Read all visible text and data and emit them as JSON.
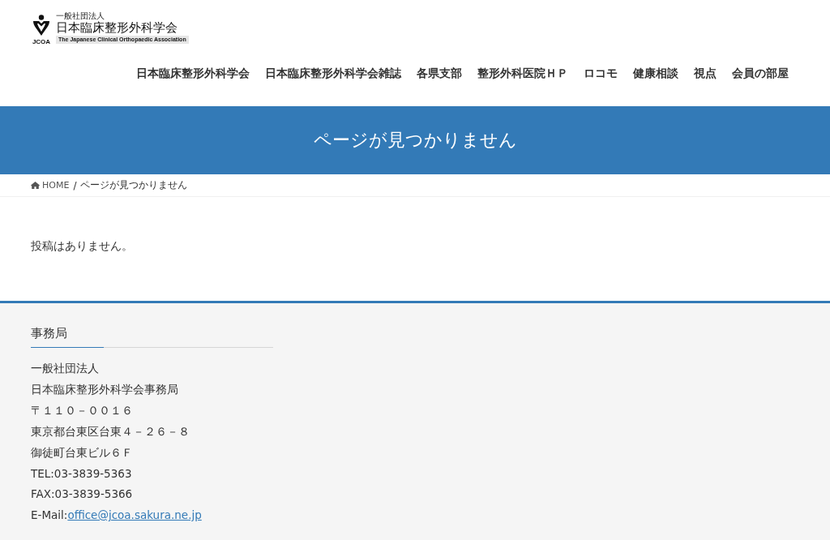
{
  "header": {
    "logo": {
      "abbr": "JCOA",
      "org_type": "一般社団法人",
      "name": "日本臨床整形外科学会",
      "english": "The Japanese Clinical Orthopaedic Association"
    },
    "nav": [
      {
        "label": "日本臨床整形外科学会"
      },
      {
        "label": "日本臨床整形外科学会雑誌"
      },
      {
        "label": "各県支部"
      },
      {
        "label": "整形外科医院ＨＰ"
      },
      {
        "label": "ロコモ"
      },
      {
        "label": "健康相談"
      },
      {
        "label": "視点"
      },
      {
        "label": "会員の部屋"
      }
    ]
  },
  "banner": {
    "title": "ページが見つかりません"
  },
  "breadcrumb": {
    "separator": "/",
    "items": [
      {
        "kind": "home",
        "label": "HOME"
      },
      {
        "kind": "current",
        "label": "ページが見つかりません"
      }
    ]
  },
  "content": {
    "message": "投稿はありません。"
  },
  "footer": {
    "title": "事務局",
    "lines": [
      "一般社団法人",
      "日本臨床整形外科学会事務局",
      "〒１１０－００１６",
      "東京都台東区台東４－２６－８",
      "御徒町台東ビル６Ｆ",
      "TEL:03-3839-5363",
      "FAX:03-3839-5366"
    ],
    "email": {
      "label": "E-Mail:",
      "link": "office@jcoa.sakura.ne.jp"
    }
  }
}
